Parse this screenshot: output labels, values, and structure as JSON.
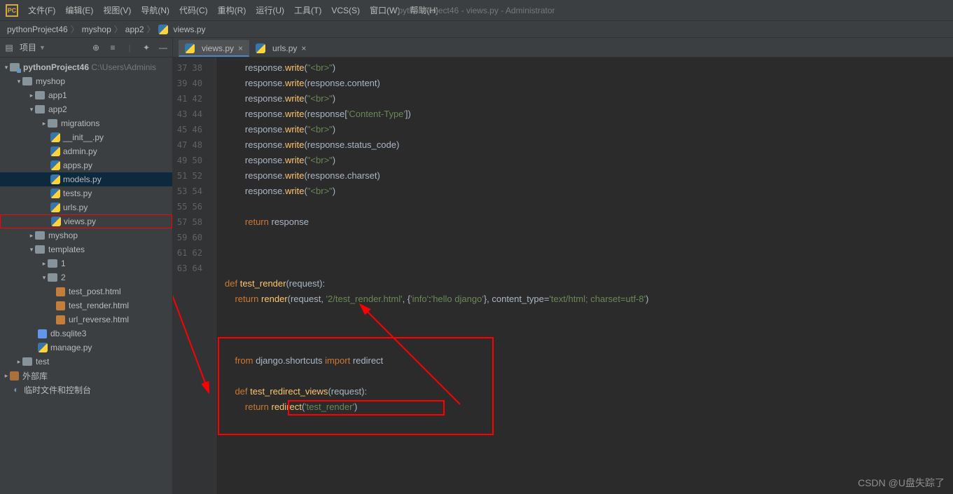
{
  "window": {
    "title": "pythonProject46 - views.py - Administrator"
  },
  "menus": [
    "文件(F)",
    "编辑(E)",
    "视图(V)",
    "导航(N)",
    "代码(C)",
    "重构(R)",
    "运行(U)",
    "工具(T)",
    "VCS(S)",
    "窗口(W)",
    "帮助(H)"
  ],
  "breadcrumb": {
    "p0": "pythonProject46",
    "p1": "myshop",
    "p2": "app2",
    "p3": "views.py"
  },
  "sidebar": {
    "title": "项目",
    "items": {
      "root": "pythonProject46",
      "root_hint": "C:\\Users\\Adminis",
      "myshop": "myshop",
      "app1": "app1",
      "app2": "app2",
      "migrations": "migrations",
      "init": "__init__.py",
      "admin": "admin.py",
      "apps": "apps.py",
      "models": "models.py",
      "tests": "tests.py",
      "urls": "urls.py",
      "views": "views.py",
      "myshop2": "myshop",
      "templates": "templates",
      "t1": "1",
      "t2": "2",
      "test_post": "test_post.html",
      "test_render": "test_render.html",
      "url_reverse": "url_reverse.html",
      "dbsqlite": "db.sqlite3",
      "manage": "manage.py",
      "test": "test",
      "extlib": "外部库",
      "scratch": "临时文件和控制台"
    }
  },
  "tabs": {
    "t0": "views.py",
    "t1": "urls.py"
  },
  "gutter": {
    "start": 37,
    "end": 64
  },
  "code": {
    "l37": "        response.write(\"<br>\")",
    "l38": "        response.write(response.content)",
    "l39": "        response.write(\"<br>\")",
    "l40": "        response.write(response['Content-Type'])",
    "l41": "        response.write(\"<br>\")",
    "l42": "        response.write(response.status_code)",
    "l43": "        response.write(\"<br>\")",
    "l44": "        response.write(response.charset)",
    "l45": "        response.write(\"<br>\")",
    "l46": "",
    "l47": "        return response",
    "l48": "",
    "l49": "",
    "l50": "",
    "l51": "def test_render(request):",
    "l52": "    return render(request, '2/test_render.html', {'info':'hello django'}, content_type='text/html; charset=utf-8')",
    "l53": "",
    "l54": "",
    "l55": "",
    "l56": "    from django.shortcuts import redirect",
    "l57": "    ",
    "l58": "    def test_redirect_views(request):",
    "l59": "        return redirect('test_render')",
    "l60": ""
  },
  "watermark": "CSDN @U盘失踪了"
}
